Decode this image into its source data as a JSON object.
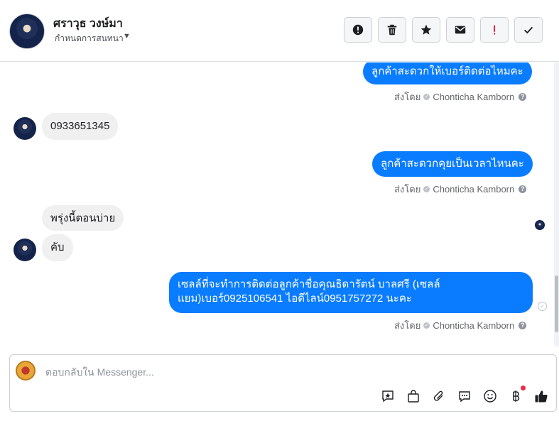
{
  "header": {
    "contact_name": "ศราวุธ วงษ์มา",
    "subtitle": "กำหนดการสนทนา",
    "caret": "⏷"
  },
  "header_actions": [
    {
      "name": "report-button",
      "icon": "exclamation-circle-icon"
    },
    {
      "name": "delete-button",
      "icon": "trash-icon"
    },
    {
      "name": "star-button",
      "icon": "star-icon"
    },
    {
      "name": "mark-unread-button",
      "icon": "envelope-icon"
    },
    {
      "name": "follow-up-button",
      "icon": "exclamation-icon",
      "color": "#e41e3f"
    },
    {
      "name": "mark-done-button",
      "icon": "checkmark-icon"
    }
  ],
  "messages": {
    "out1": "ลูกค้าสะดวกให้เบอร์ติดต่อไหมคะ",
    "in1": "0933651345",
    "out2": "ลูกค้าสะดวกคุยเป็นเวลาไหนคะ",
    "in2": "พรุ่งนี้ตอนบ่าย",
    "in3": "คับ",
    "out3": "เซลล์ที่จะทำการติดต่อลูกค้าชื่อคุณธิดารัตน์ บาลศรี (เซลล์แยม)เบอร์0925106541 ไอดีไลน์0951757272 นะคะ"
  },
  "sent_by": {
    "prefix": "ส่งโดย",
    "agent": "Chonticha Kamborn"
  },
  "composer": {
    "placeholder": "ตอบกลับใน Messenger..."
  },
  "composer_tools": [
    "saved-reply-icon",
    "shopping-bag-icon",
    "paperclip-icon",
    "chat-bubble-icon",
    "emoji-icon",
    "baht-payment-icon",
    "thumbs-up-icon"
  ],
  "colors": {
    "accent": "#0a7cff",
    "incoming_bubble": "#f0f0f0",
    "alert_red": "#e41e3f"
  }
}
